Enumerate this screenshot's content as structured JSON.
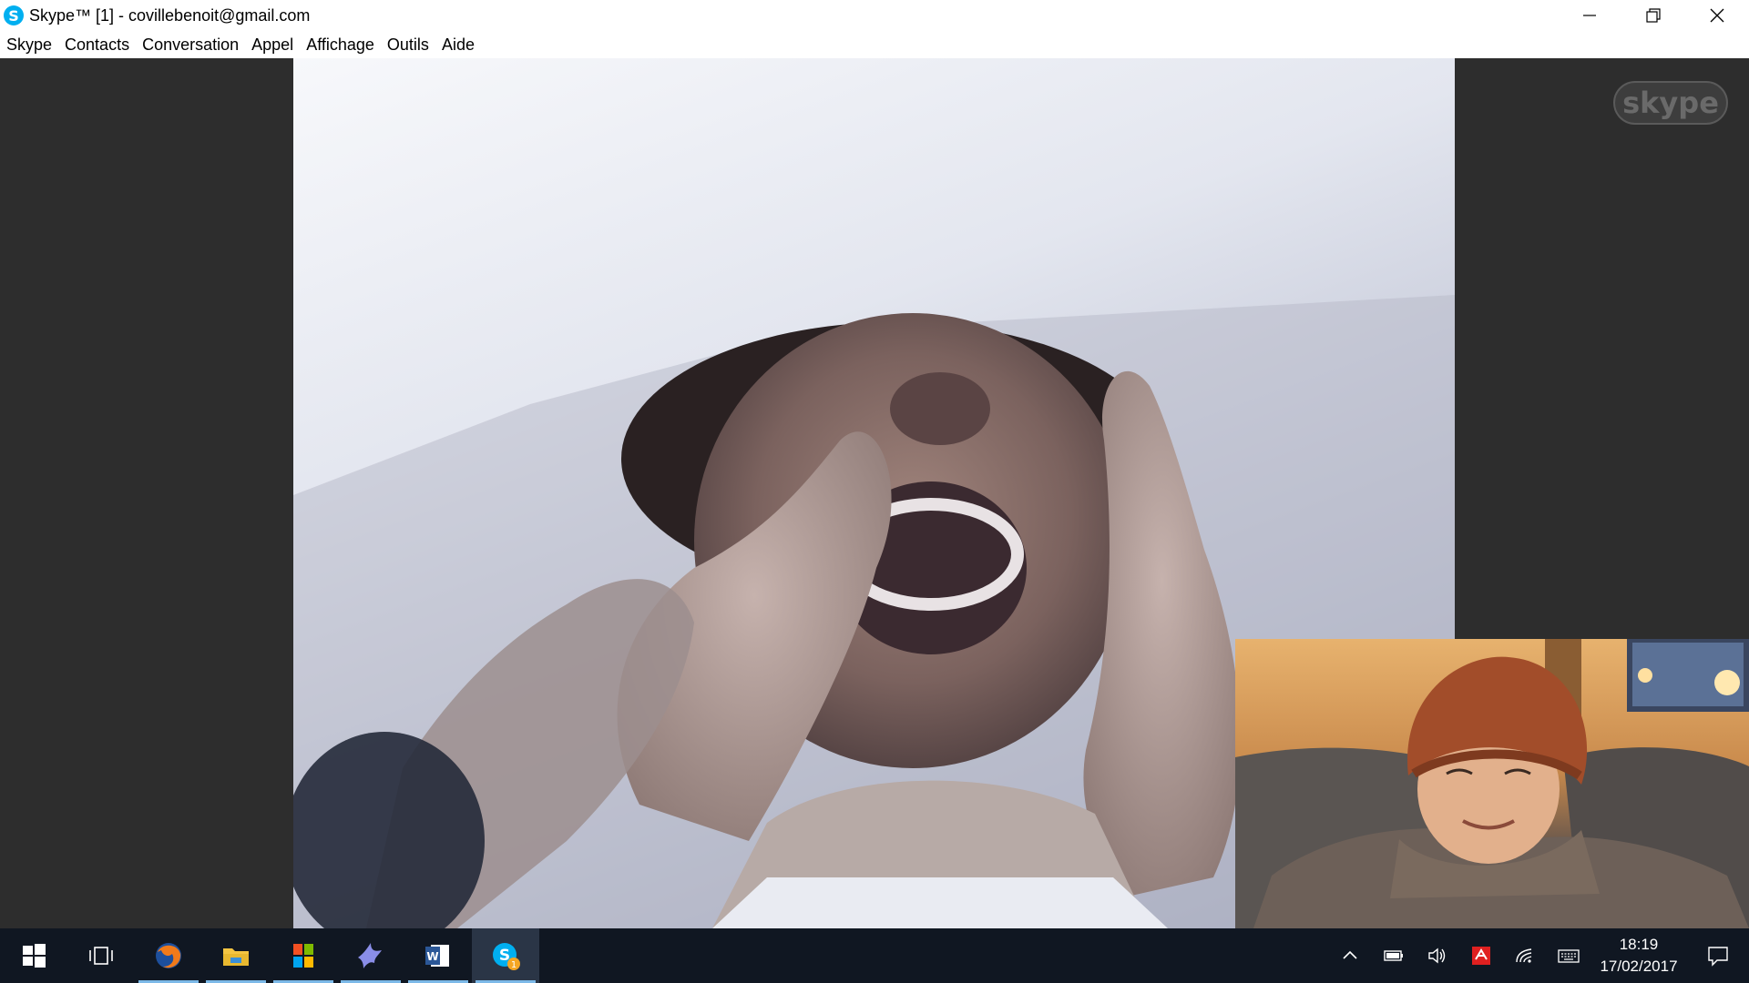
{
  "window": {
    "title": "Skype™ [1] - covillebenoit@gmail.com",
    "app_icon": "skype-icon"
  },
  "menu": [
    "Skype",
    "Contacts",
    "Conversation",
    "Appel",
    "Affichage",
    "Outils",
    "Aide"
  ],
  "call": {
    "watermark": "skype"
  },
  "taskbar": {
    "apps": [
      {
        "icon": "windows-start-icon"
      },
      {
        "icon": "task-view-icon"
      },
      {
        "icon": "firefox-icon",
        "pinned": true
      },
      {
        "icon": "file-explorer-icon",
        "pinned": true
      },
      {
        "icon": "windows-store-icon",
        "pinned": true
      },
      {
        "icon": "bird-app-icon",
        "pinned": true
      },
      {
        "icon": "word-icon",
        "pinned": true
      },
      {
        "icon": "skype-taskbar-icon",
        "pinned": true,
        "active": true,
        "badge": "1"
      }
    ],
    "tray": [
      "chevron-up-icon",
      "battery-icon",
      "volume-icon",
      "antivirus-icon",
      "wifi-icon",
      "keyboard-icon"
    ],
    "time": "18:19",
    "date": "17/02/2017"
  },
  "colors": {
    "skype_blue": "#00aff0",
    "taskbar": "#101722",
    "call_background": "#2d2d2d"
  }
}
